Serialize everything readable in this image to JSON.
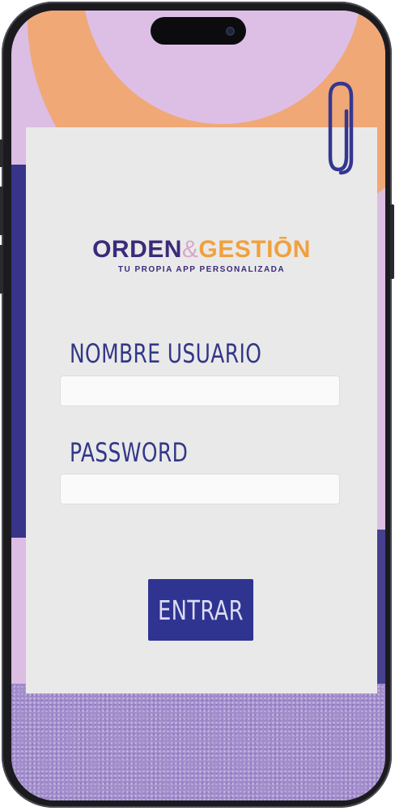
{
  "brand": {
    "name_part1": "ORDEN",
    "name_ampersand": "&",
    "name_part2": "GESTIŌN",
    "tagline": "TU PROPIA APP PERSONALIZADA",
    "colors": {
      "primary": "#3b2a7a",
      "accent": "#f0a13e",
      "button": "#2f3491"
    }
  },
  "login": {
    "username_label": "NOMBRE USUARIO",
    "username_value": "",
    "password_label": "PASSWORD",
    "password_value": "",
    "submit_label": "ENTRAR"
  },
  "decor": {
    "icons": [
      "paperclip-icon",
      "front-camera-icon"
    ]
  }
}
